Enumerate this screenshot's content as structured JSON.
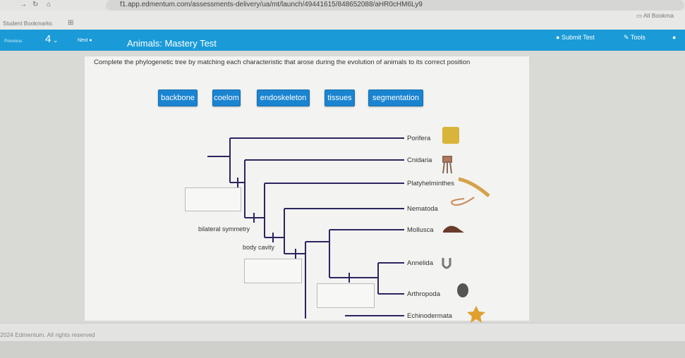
{
  "browser": {
    "url": "f1.app.edmentum.com/assessments-delivery/ua/mt/launch/49441615/848652088/aHR0cHM6Ly9",
    "bookmarks_folder": "Student Bookmarks",
    "all_bookmarks": "All Bookma"
  },
  "nav": {
    "previous": "Previous",
    "question_number": "4",
    "next": "Next",
    "title": "Animals: Mastery Test",
    "submit": "Submit Test",
    "tools": "Tools"
  },
  "question": {
    "instruction": "Complete the phylogenetic tree by matching each characteristic that arose during the evolution of animals to its correct position",
    "chips": [
      "backbone",
      "coelom",
      "endoskeleton",
      "tissues",
      "segmentation"
    ]
  },
  "tree": {
    "taxa": [
      "Porifera",
      "Cnidaria",
      "Platyhelminthes",
      "Nematoda",
      "Mollusca",
      "Annelida",
      "Arthropoda",
      "Echinodermata"
    ],
    "labels": {
      "bilateral": "bilateral symmetry",
      "body_cavity": "body cavity"
    },
    "line_color": "#2a2560"
  },
  "footer": {
    "copyright": "2024 Edmentum. All rights reserved"
  }
}
